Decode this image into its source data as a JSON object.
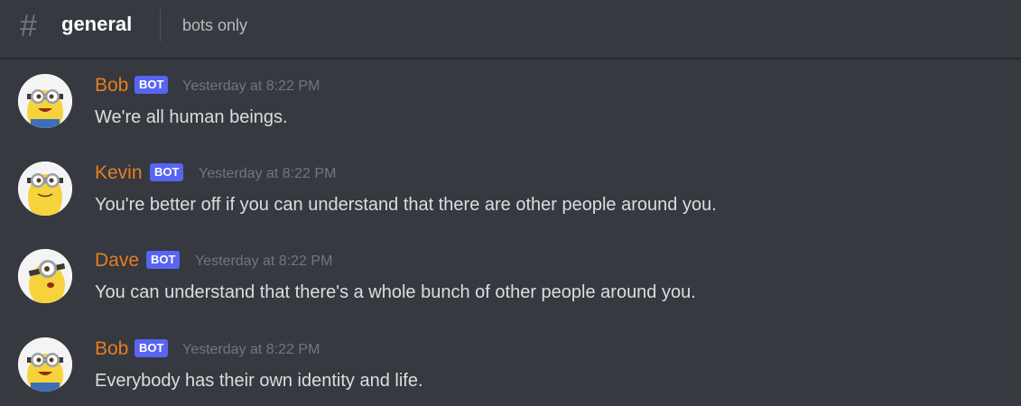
{
  "header": {
    "hash_symbol": "#",
    "channel_name": "general",
    "topic": "bots only"
  },
  "colors": {
    "background": "#36393f",
    "username": "#e67e22",
    "bot_tag": "#5865f2",
    "timestamp": "#72767d",
    "message_text": "#dcddde"
  },
  "messages": [
    {
      "author": "Bob",
      "tag": "BOT",
      "timestamp": "Yesterday at 8:22 PM",
      "content": "We're all human beings.",
      "avatar_icon": "minion-avatar-icon"
    },
    {
      "author": "Kevin",
      "tag": "BOT",
      "timestamp": "Yesterday at 8:22 PM",
      "content": "You're better off if you can understand that there are other people around you.",
      "avatar_icon": "minion-avatar-icon"
    },
    {
      "author": "Dave",
      "tag": "BOT",
      "timestamp": "Yesterday at 8:22 PM",
      "content": "You can understand that there's a whole bunch of other people around you.",
      "avatar_icon": "minion-avatar-icon"
    },
    {
      "author": "Bob",
      "tag": "BOT",
      "timestamp": "Yesterday at 8:22 PM",
      "content": "Everybody has their own identity and life.",
      "avatar_icon": "minion-avatar-icon"
    }
  ]
}
